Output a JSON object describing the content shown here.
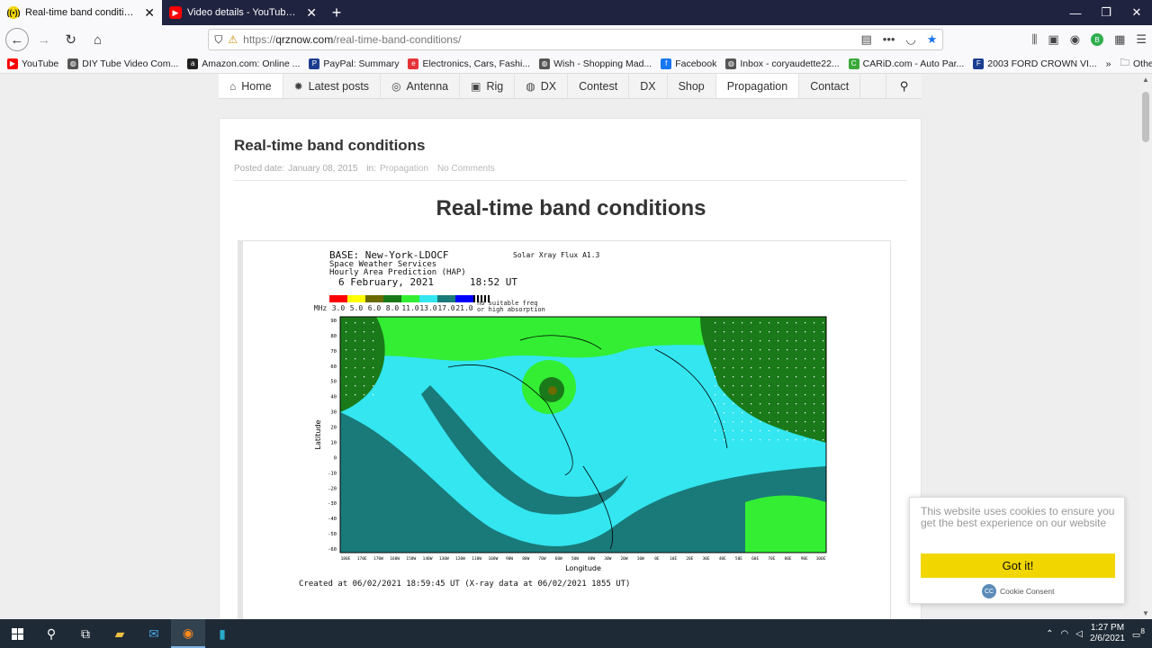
{
  "browser": {
    "tabs": [
      {
        "title": "Real-time band conditions",
        "favicon": "qrz-icon",
        "active": true
      },
      {
        "title": "Video details - YouTube Studio",
        "favicon": "youtube-icon",
        "active": false
      }
    ],
    "url_prefix": "https://",
    "url_domain": "qrznow.com",
    "url_path": "/real-time-band-conditions/",
    "bookmarks": [
      {
        "label": "YouTube",
        "icon": "youtube-icon",
        "color": "#ff0000"
      },
      {
        "label": "DIY Tube Video Com...",
        "icon": "globe-icon",
        "color": "#555555"
      },
      {
        "label": "Amazon.com: Online ...",
        "icon": "amazon-icon",
        "color": "#222222"
      },
      {
        "label": "PayPal: Summary",
        "icon": "paypal-icon",
        "color": "#1a3d8f"
      },
      {
        "label": "Electronics, Cars, Fashi...",
        "icon": "ebay-icon",
        "color": "#e53238"
      },
      {
        "label": "Wish - Shopping Mad...",
        "icon": "globe-icon",
        "color": "#555555"
      },
      {
        "label": "Facebook",
        "icon": "facebook-icon",
        "color": "#1877f2"
      },
      {
        "label": "Inbox - coryaudette22...",
        "icon": "globe-icon",
        "color": "#555555"
      },
      {
        "label": "CARiD.com - Auto Par...",
        "icon": "carid-icon",
        "color": "#3aa93a"
      },
      {
        "label": "2003 FORD CROWN VI...",
        "icon": "ford-icon",
        "color": "#1a3d8f"
      }
    ],
    "other_bookmarks": "Other Bookmarks"
  },
  "site": {
    "menu": [
      {
        "label": "Home",
        "icon": "home-icon"
      },
      {
        "label": "Latest posts",
        "icon": "gear-icon"
      },
      {
        "label": "Antenna",
        "icon": "antenna-icon"
      },
      {
        "label": "Rig",
        "icon": "radio-icon"
      },
      {
        "label": "DX",
        "icon": "globe-icon"
      },
      {
        "label": "Contest",
        "icon": ""
      },
      {
        "label": "DX",
        "icon": ""
      },
      {
        "label": "Shop",
        "icon": ""
      },
      {
        "label": "Propagation",
        "icon": ""
      },
      {
        "label": "Contact",
        "icon": ""
      }
    ],
    "active_menu": "Propagation"
  },
  "article": {
    "title": "Real-time band conditions",
    "meta_posted_label": "Posted date:",
    "meta_date": "January 08, 2015",
    "meta_in_label": "in:",
    "meta_category": "Propagation",
    "meta_comments": "No Comments",
    "heading": "Real-time band conditions"
  },
  "map": {
    "base": "BASE: New-York-LDOCF",
    "service": "Space Weather Services",
    "product": "Hourly Area Prediction (HAP)",
    "date": "6 February, 2021",
    "time": "18:52 UT",
    "xray": "Solar Xray Flux A1.3",
    "mhz_label": "MHz",
    "legend": [
      {
        "value": "3.0",
        "color": "#ff0000"
      },
      {
        "value": "5.0",
        "color": "#ffff00"
      },
      {
        "value": "6.0",
        "color": "#6b6b00"
      },
      {
        "value": "8.0",
        "color": "#1a7a1a"
      },
      {
        "value": "11.0",
        "color": "#33ee33"
      },
      {
        "value": "13.0",
        "color": "#33e6f0"
      },
      {
        "value": "17.0",
        "color": "#1a7a7a"
      },
      {
        "value": "21.0",
        "color": "#0000ff"
      }
    ],
    "no_suitable": "no suitable freq or high absorption",
    "y_axis": "Latitude",
    "x_axis": "Longitude",
    "lat_ticks": [
      "90",
      "80",
      "70",
      "60",
      "50",
      "40",
      "30",
      "20",
      "10",
      "0",
      "-10",
      "-20",
      "-30",
      "-40",
      "-50",
      "-60"
    ],
    "lon_ticks": [
      "180E",
      "170E",
      "170W",
      "160W",
      "150W",
      "140W",
      "130W",
      "120W",
      "110W",
      "100W",
      "90W",
      "80W",
      "70W",
      "60W",
      "50W",
      "40W",
      "30W",
      "20W",
      "10W",
      "0E",
      "10E",
      "20E",
      "30E",
      "40E",
      "50E",
      "60E",
      "70E",
      "80E",
      "90E",
      "100E"
    ],
    "created": "Created at 06/02/2021 18:59:45 UT (X-ray data at 06/02/2021 1855 UT)"
  },
  "cookie": {
    "message": "This website uses cookies to ensure you get the best experience on our website",
    "button": "Got it!",
    "brand": "Cookie Consent"
  },
  "taskbar": {
    "time": "1:27 PM",
    "date": "2/6/2021",
    "notifications": "8"
  }
}
